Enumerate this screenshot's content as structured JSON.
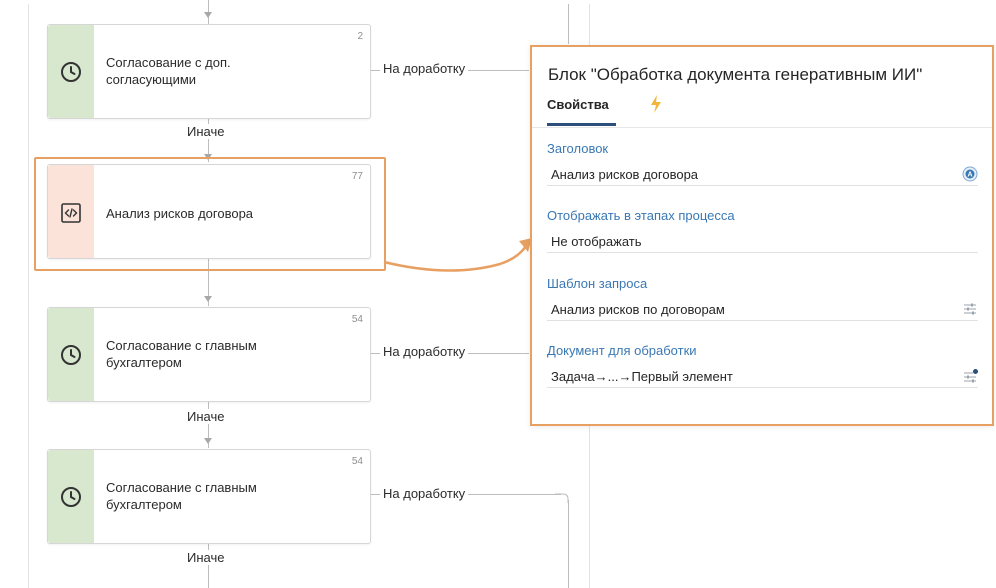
{
  "flow": {
    "blocks": [
      {
        "label_line1": "Согласование с доп.",
        "label_line2": "согласующими",
        "number": "2",
        "branch": "На доработку",
        "else": "Иначе",
        "icon": "clock-icon"
      },
      {
        "label_line1": "Анализ рисков договора",
        "label_line2": "",
        "number": "77",
        "icon": "code-icon"
      },
      {
        "label_line1": "Согласование с главным",
        "label_line2": "бухгалтером",
        "number": "54",
        "branch": "На доработку",
        "else": "Иначе",
        "icon": "clock-icon"
      },
      {
        "label_line1": "Согласование с главным",
        "label_line2": "бухгалтером",
        "number": "54",
        "branch": "На доработку",
        "else": "Иначе",
        "icon": "clock-icon"
      }
    ]
  },
  "panel": {
    "title": "Блок \"Обработка документа генеративным ИИ\"",
    "tabs": [
      {
        "label": "Свойства",
        "active": true
      },
      {
        "label": "",
        "icon": "lightning-icon"
      }
    ],
    "fields": [
      {
        "label": "Заголовок",
        "value": "Анализ рисков договора",
        "icon": "ai-badge-icon"
      },
      {
        "label": "Отображать в этапах процесса",
        "value": "Не отображать"
      },
      {
        "label": "Шаблон запроса",
        "value": "Анализ рисков по договорам",
        "icon": "sliders-icon"
      },
      {
        "label": "Документ для обработки",
        "value": "Задача→...→Первый элемент",
        "icon": "sliders-dot-icon"
      }
    ]
  },
  "colors": {
    "highlight": "#e8a062",
    "green_strip": "#d7e8cf",
    "peach_strip": "#fbe3da",
    "link_blue": "#3a78b4",
    "tab_underline": "#2d4f7c",
    "bolt": "#f2b43a"
  }
}
